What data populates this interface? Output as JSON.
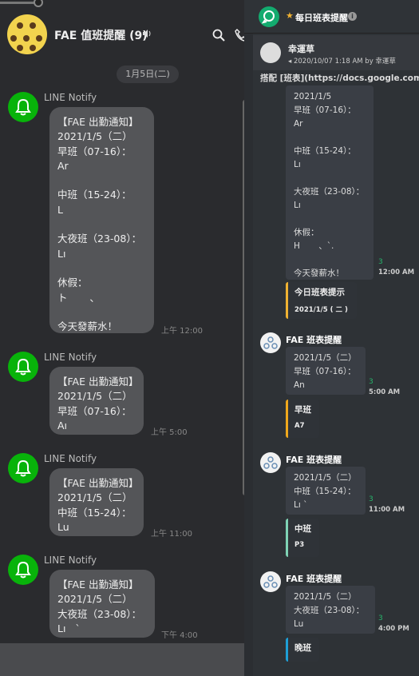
{
  "left": {
    "chat_title": "FAE 值班提醒 (9)",
    "date_separator": "1月5日(二)",
    "messages": [
      {
        "sender": "LINE Notify",
        "text": "【FAE 出勤通知】\n2021/1/5（二）\n早班（07-16）：\nAr\n\n中班（15-24）：\nL\n\n大夜班（23-08）：\nLı\n\n休假：\nト       、\n\n今天發薪水！",
        "time": "上午 12:00"
      },
      {
        "sender": "LINE Notify",
        "text": "【FAE 出勤通知】\n2021/1/5（二）\n早班（07-16）：\nAı",
        "time": "上午 5:00"
      },
      {
        "sender": "LINE Notify",
        "text": "【FAE 出勤通知】\n2021/1/5（二）\n中班（15-24）：\nLu",
        "time": "上午 11:00"
      },
      {
        "sender": "LINE Notify",
        "text": "【FAE 出勤通知】\n2021/1/5（二）\n大夜班（23-08）：\nLı   `",
        "time": "下午 4:00"
      }
    ]
  },
  "right": {
    "channel_title": "每日班表提醒",
    "pinned": {
      "name": "幸運草",
      "meta": "2020/10/07 1:18 AM by 幸運草",
      "message": "搭配 [班表](https://docs.google.com/sp"
    },
    "first_block": {
      "text": "2021/1/5\n早班（07-16）：\nAr\n\n中班（15-24）：\nLı\n\n大夜班（23-08）：\nLı\n\n休假：\nH       、`.\n\n今天發薪水！",
      "count": "3",
      "time": "12:00 AM",
      "embed_title": "今日班表提示",
      "embed_desc": "2021/1/5 ( 二 )",
      "accent": "#f0b232"
    },
    "bot_messages": [
      {
        "name": "FAE 班表提醒",
        "text": "2021/1/5（二）\n早班（07-16）：\nAn",
        "count": "3",
        "time": "5:00 AM",
        "embed_title": "早班",
        "embed_desc": "A7",
        "accent": "#f0a81c"
      },
      {
        "name": "FAE 班表提醒",
        "text": "2021/1/5（二）\n中班（15-24）：\nLı `",
        "count": "3",
        "time": "11:00 AM",
        "embed_title": "中班",
        "embed_desc": "P3",
        "accent": "#7fd3b5"
      },
      {
        "name": "FAE 班表提醒",
        "text": "2021/1/5（二）\n大夜班（23-08）：\nLu",
        "count": "3",
        "time": "4:00 PM",
        "embed_title": "晚班",
        "embed_desc": "",
        "accent": "#1e9fd6"
      }
    ]
  }
}
